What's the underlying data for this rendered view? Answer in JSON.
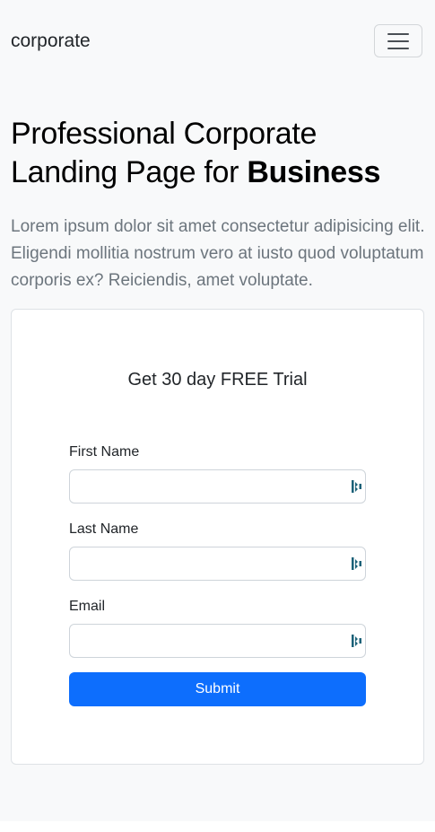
{
  "navbar": {
    "brand": "corporate",
    "toggle_icon": "hamburger-menu-icon"
  },
  "hero": {
    "title_prefix": "Professional Corporate Landing Page for ",
    "title_emphasis": "Business",
    "lead": "Lorem ipsum dolor sit amet consectetur adipisicing elit. Eligendi mollitia nostrum vero at iusto quod voluptatum corporis ex? Reiciendis, amet voluptate."
  },
  "form": {
    "title": "Get 30 day FREE Trial",
    "fields": [
      {
        "label": "First Name",
        "value": "",
        "placeholder": ""
      },
      {
        "label": "Last Name",
        "value": "",
        "placeholder": ""
      },
      {
        "label": "Email",
        "value": "",
        "placeholder": ""
      }
    ],
    "field_icon": "autofill-extension-icon",
    "submit_label": "Submit"
  },
  "colors": {
    "page_background": "#f8f9fa",
    "primary_button": "#0d6efd",
    "muted_text": "#6c757d",
    "autofill_icon": "#1b6178"
  }
}
